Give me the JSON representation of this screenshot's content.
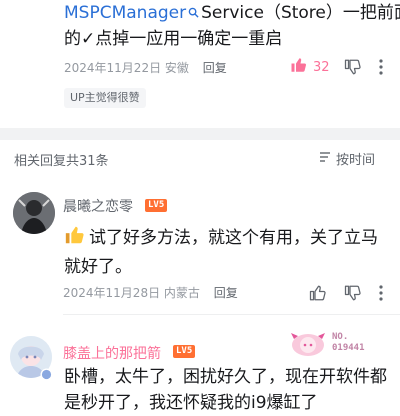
{
  "top_comment": {
    "link_text": "MSPCManager",
    "line1_rest": "Service（Store）一把前面",
    "line2": "的✓点掉一应用一确定一重启",
    "date": "2024年11月22日",
    "location": "安徽",
    "reply_label": "回复",
    "like_count": "32",
    "up_badge": "UP主觉得很赞"
  },
  "replies_header": {
    "title": "相关回复共31条",
    "sort_label": "按时间"
  },
  "comment1": {
    "username": "晨曦之恋零",
    "level": "LV5",
    "text_line1": "试了好多方法，就这个有用，关了立马",
    "text_line2": "就好了。",
    "date": "2024年11月28日",
    "location": "内蒙古",
    "reply_label": "回复"
  },
  "comment2": {
    "username": "膝盖上的那把箭",
    "level": "LV5",
    "badge_no": "NO.",
    "badge_num": "019441",
    "text_line1": "卧槽，太牛了，困扰好久了，现在开软件都",
    "text_line2": "是秒开了，我还怀疑我的i9爆缸了"
  },
  "colors": {
    "like_active": "#fb7299",
    "link": "#2a6fd6",
    "level_badge": "#ff6f32"
  }
}
